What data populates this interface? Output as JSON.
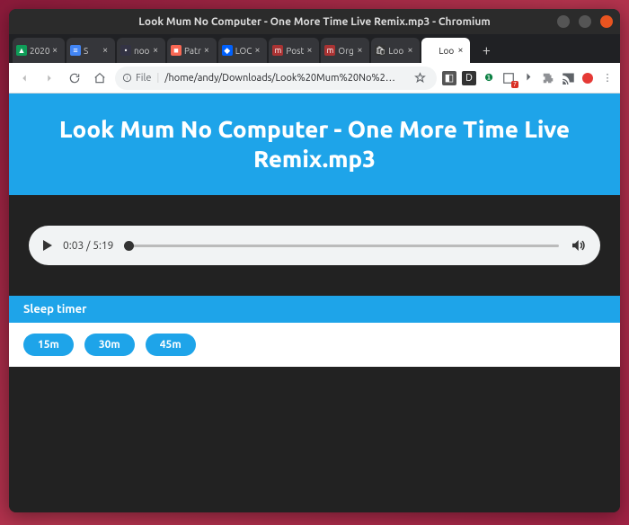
{
  "window": {
    "title": "Look Mum No Computer - One More Time Live Remix.mp3 - Chromium"
  },
  "tabs": [
    {
      "label": "2020",
      "favicon_bg": "#0f9d58",
      "favicon_char": "▲"
    },
    {
      "label": "S",
      "favicon_bg": "#4285f4",
      "favicon_char": "≡"
    },
    {
      "label": "noo",
      "favicon_bg": "#334",
      "favicon_char": "•"
    },
    {
      "label": "Patr",
      "favicon_bg": "#f96854",
      "favicon_char": "■"
    },
    {
      "label": "LOC",
      "favicon_bg": "#0061fe",
      "favicon_char": "◆"
    },
    {
      "label": "Post",
      "favicon_bg": "#a33",
      "favicon_char": "m"
    },
    {
      "label": "Org",
      "favicon_bg": "#a33",
      "favicon_char": "m"
    },
    {
      "label": "Loo",
      "favicon_bg": "#333",
      "favicon_char": "🛍"
    },
    {
      "label": "Loo",
      "favicon_bg": "#fff",
      "favicon_char": "",
      "active": true
    }
  ],
  "toolbar": {
    "file_chip": "File",
    "url": "/home/andy/Downloads/Look%20Mum%20No%2…"
  },
  "page": {
    "title": "Look Mum No Computer - One More Time Live Remix.mp3",
    "player": {
      "current": "0:03",
      "duration": "5:19",
      "progress_pct": 1
    },
    "sleep_timer_heading": "Sleep timer",
    "timers": [
      "15m",
      "30m",
      "45m"
    ]
  }
}
